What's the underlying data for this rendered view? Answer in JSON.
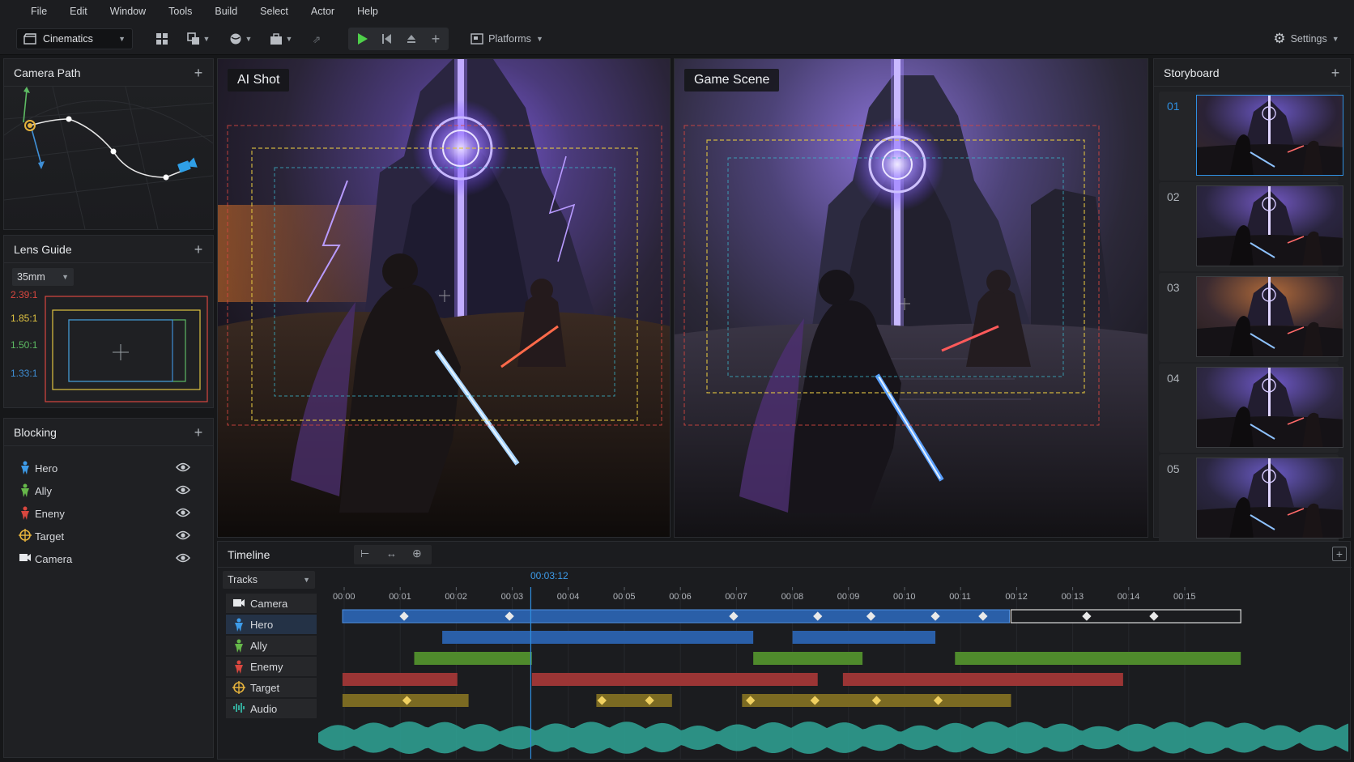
{
  "menu": [
    "File",
    "Edit",
    "Window",
    "Tools",
    "Build",
    "Select",
    "Actor",
    "Help"
  ],
  "toolbar": {
    "mode": "Cinematics",
    "platforms": "Platforms",
    "settings": "Settings"
  },
  "camera_path": {
    "title": "Camera Path"
  },
  "lens_guide": {
    "title": "Lens Guide",
    "lens": "35mm",
    "ratios": [
      {
        "label": "2.39:1",
        "color": "#d9473f"
      },
      {
        "label": "1.85:1",
        "color": "#e0c341"
      },
      {
        "label": "1.50:1",
        "color": "#5dbb63"
      },
      {
        "label": "1.33:1",
        "color": "#3f8fd6"
      }
    ]
  },
  "blocking": {
    "title": "Blocking",
    "items": [
      {
        "label": "Hero",
        "icon": "person-icon",
        "color": "#3d9be9"
      },
      {
        "label": "Ally",
        "icon": "person-icon",
        "color": "#66b84a"
      },
      {
        "label": "Eneny",
        "icon": "person-icon",
        "color": "#d9473f"
      },
      {
        "label": "Target",
        "icon": "target-icon",
        "color": "#e5b23c"
      },
      {
        "label": "Camera",
        "icon": "camera-icon",
        "color": "#e6e8eb"
      }
    ]
  },
  "viewports": {
    "left_label": "AI Shot",
    "right_label": "Game Scene"
  },
  "storyboard": {
    "title": "Storyboard",
    "shots": [
      "01",
      "02",
      "03",
      "04",
      "05"
    ],
    "selected": "01"
  },
  "timeline": {
    "title": "Timeline",
    "tracks_dropdown": "Tracks",
    "playhead": "00:03:12",
    "ticks": [
      "00:00",
      "00:01",
      "00:02",
      "00:03",
      "00:04",
      "00:05",
      "00:06",
      "00:07",
      "00:08",
      "00:09",
      "00:10",
      "00:11",
      "00:12",
      "00:13",
      "00:14",
      "00:15"
    ],
    "tracks": [
      {
        "label": "Camera",
        "icon": "camera-icon",
        "color": "#e6e8eb"
      },
      {
        "label": "Hero",
        "icon": "person-icon",
        "color": "#3d9be9"
      },
      {
        "label": "Ally",
        "icon": "person-icon",
        "color": "#66b84a"
      },
      {
        "label": "Enemy",
        "icon": "person-icon",
        "color": "#d9473f"
      },
      {
        "label": "Target",
        "icon": "target-icon",
        "color": "#e5b23c"
      },
      {
        "label": "Audio",
        "icon": "audio-icon",
        "color": "#35b8a6"
      }
    ]
  },
  "colors": {
    "accent": "#2f8fe0",
    "hero_clip": "#2a5fa8",
    "ally_clip": "#4f8a2c",
    "enemy_clip": "#9b3535",
    "target_clip": "#7b6a22",
    "waveform": "#2fa596"
  }
}
